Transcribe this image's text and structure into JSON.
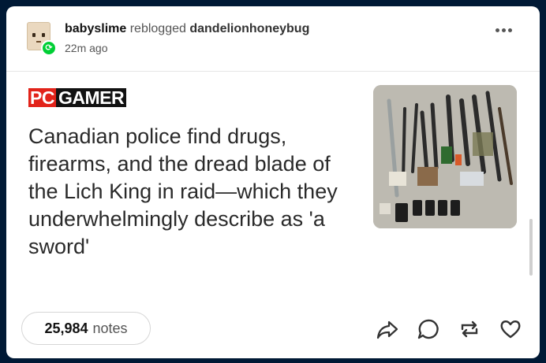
{
  "post": {
    "username": "babyslime",
    "reblog_text": "reblogged",
    "reblogged_from": "dandelionhoneybug",
    "timestamp": "22m ago"
  },
  "article": {
    "source_logo_pc": "PC",
    "source_logo_rest": "GAMER",
    "headline": "Canadian police find drugs, firearms, and the dread blade of the Lich King in raid—which they underwhelmingly describe as 'a sword'"
  },
  "footer": {
    "notes_count": "25,984",
    "notes_label": "notes"
  },
  "icons": {
    "more": "more-icon",
    "share": "share-icon",
    "reply": "reply-icon",
    "reblog": "reblog-icon",
    "like": "heart-icon",
    "reblog_badge": "reblog-badge-icon"
  },
  "colors": {
    "background": "#001935",
    "card": "#ffffff",
    "reblog_green": "#00cf35",
    "pc_red": "#e2231a"
  }
}
